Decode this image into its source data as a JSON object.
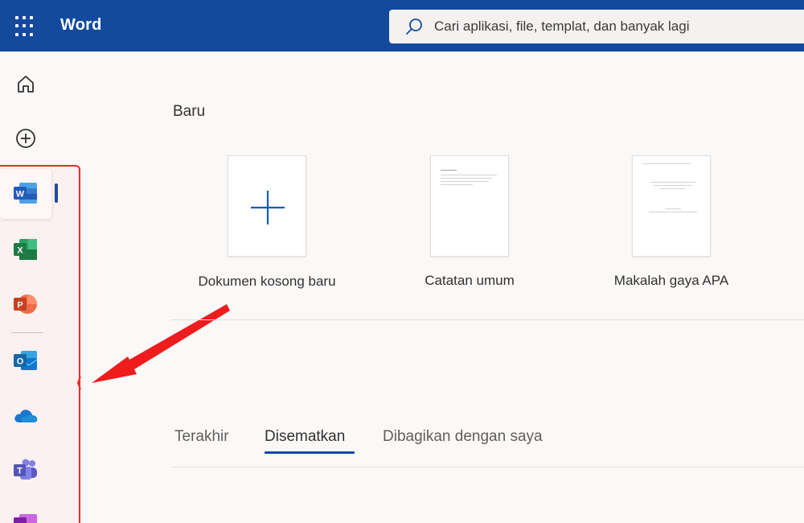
{
  "header": {
    "app_name": "Word",
    "search_placeholder": "Cari aplikasi, file, templat, dan banyak lagi"
  },
  "rail": {
    "items": [
      {
        "icon": "home-icon"
      },
      {
        "icon": "create-icon"
      },
      {
        "icon": "word-icon",
        "letter": "W",
        "active": true
      },
      {
        "icon": "excel-icon",
        "letter": "X"
      },
      {
        "icon": "powerpoint-icon",
        "letter": "P"
      },
      {
        "icon": "outlook-icon",
        "letter": "O"
      },
      {
        "icon": "onedrive-icon"
      },
      {
        "icon": "teams-icon",
        "letter": "T"
      },
      {
        "icon": "onenote-icon"
      }
    ]
  },
  "new_section": {
    "title": "Baru",
    "templates": [
      {
        "label": "Dokumen kosong baru"
      },
      {
        "label": "Catatan umum"
      },
      {
        "label": "Makalah gaya APA"
      }
    ]
  },
  "tabs": [
    {
      "label": "Terakhir",
      "active": false
    },
    {
      "label": "Disematkan",
      "active": true
    },
    {
      "label": "Dibagikan dengan saya",
      "active": false
    }
  ],
  "colors": {
    "header": "#134a9e",
    "annotation": "#ee2b2b",
    "word": "#185abd",
    "excel": "#107c41",
    "powerpoint": "#c43e1c",
    "outlook": "#0a64ad",
    "onedrive": "#0f78d4",
    "teams": "#5059c9",
    "onenote": "#7719aa"
  }
}
